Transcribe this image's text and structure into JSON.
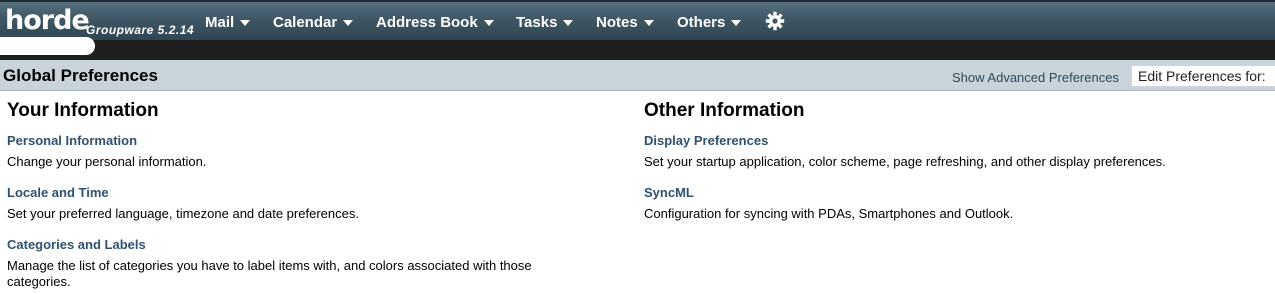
{
  "app": {
    "logo": "horde",
    "product": "Groupware 5.2.14"
  },
  "nav": {
    "items": [
      {
        "label": "Mail"
      },
      {
        "label": "Calendar"
      },
      {
        "label": "Address Book"
      },
      {
        "label": "Tasks"
      },
      {
        "label": "Notes"
      },
      {
        "label": "Others"
      }
    ],
    "settings_icon": "gear-icon"
  },
  "header": {
    "title": "Global Preferences",
    "advanced_link": "Show Advanced Preferences",
    "edit_for": "Edit Preferences for:"
  },
  "sections": {
    "left": {
      "heading": "Your Information",
      "items": [
        {
          "title": "Personal Information",
          "desc": "Change your personal information."
        },
        {
          "title": "Locale and Time",
          "desc": "Set your preferred language, timezone and date preferences."
        },
        {
          "title": "Categories and Labels",
          "desc": "Manage the list of categories you have to label items with, and colors associated with those categories."
        }
      ]
    },
    "right": {
      "heading": "Other Information",
      "items": [
        {
          "title": "Display Preferences",
          "desc": "Set your startup application, color scheme, page refreshing, and other display preferences."
        },
        {
          "title": "SyncML",
          "desc": "Configuration for syncing with PDAs, Smartphones and Outlook."
        }
      ]
    }
  },
  "colors": {
    "nav_bg": "#3f5765",
    "header_band": "#c9d3da",
    "link": "#2e5270"
  }
}
